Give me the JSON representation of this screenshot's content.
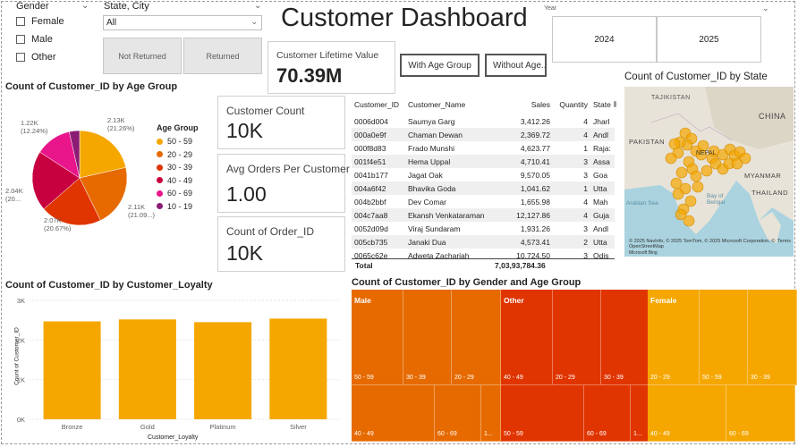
{
  "title": "Customer Dashboard",
  "slicers": {
    "gender": {
      "title": "Gender",
      "options": [
        "Female",
        "Male",
        "Other"
      ]
    },
    "state_city": {
      "title": "State, City",
      "selected": "All"
    },
    "returned": {
      "tiles": [
        "Not Returned",
        "Returned"
      ]
    },
    "year": {
      "title": "Year",
      "tiles": [
        "2024",
        "2025"
      ]
    }
  },
  "buttons": {
    "age": "With Age Group",
    "no_age": "Without Age..."
  },
  "cards": {
    "clv": {
      "label": "Customer Lifetime Value",
      "value": "70.39M"
    },
    "count": {
      "label": "Customer Count",
      "value": "10K"
    },
    "avg": {
      "label": "Avg Orders Per Customer",
      "value": "1.00"
    },
    "orders": {
      "label": "Count of Order_ID",
      "value": "10K"
    }
  },
  "pie": {
    "title": "Count of Customer_ID by Age Group",
    "legend_title": "Age Group",
    "chart_data": {
      "type": "pie",
      "slices": [
        {
          "label": "50 - 59",
          "value": 2130,
          "pct": "21.26%",
          "color": "#F5A700",
          "top_label": "2.13K",
          "pct_label": "(21.26%)"
        },
        {
          "label": "20 - 29",
          "value": 2110,
          "pct": "21.09%",
          "color": "#E66A00",
          "top_label": "2.11K",
          "pct_label": "(21.09...)"
        },
        {
          "label": "30 - 39",
          "value": 2070,
          "pct": "20.67%",
          "color": "#E03500",
          "top_label": "2.07K",
          "pct_label": "(20.67%)"
        },
        {
          "label": "40 - 49",
          "value": 2040,
          "pct": "20...",
          "color": "#C7003F",
          "top_label": "2.04K",
          "pct_label": "(20..."
        },
        {
          "label": "60 - 69",
          "value": 1220,
          "pct": "12.24%",
          "color": "#E8168A",
          "top_label": "1.22K",
          "pct_label": "(12.24%)"
        },
        {
          "label": "10 - 19",
          "value": 350,
          "pct": "",
          "color": "#8B1C74",
          "top_label": "",
          "pct_label": ""
        }
      ]
    }
  },
  "table": {
    "headers": [
      "Customer_ID",
      "Customer_Name",
      "Sales",
      "Quantity",
      "State"
    ],
    "rows": [
      [
        "0006d004",
        "Saumya Garg",
        "3,412.26",
        "4",
        "Jharl"
      ],
      [
        "000a0e9f",
        "Chaman Dewan",
        "2,369.72",
        "4",
        "Andl"
      ],
      [
        "000f8d83",
        "Frado Munshi",
        "4,623.77",
        "1",
        "Raja:"
      ],
      [
        "001f4e51",
        "Hema Uppal",
        "4,710.41",
        "3",
        "Assa"
      ],
      [
        "0041b177",
        "Jagat Oak",
        "9,570.05",
        "3",
        "Goa"
      ],
      [
        "004a6f42",
        "Bhavika Goda",
        "1,041.62",
        "1",
        "Utta"
      ],
      [
        "004b2bbf",
        "Dev Comar",
        "1,655.98",
        "4",
        "Mah"
      ],
      [
        "004c7aa8",
        "Ekansh Venkataraman",
        "12,127.86",
        "4",
        "Guja"
      ],
      [
        "0052d09d",
        "Viraj Sundaram",
        "1,931.26",
        "3",
        "Andl"
      ],
      [
        "005cb735",
        "Janaki Dua",
        "4,573.41",
        "2",
        "Utta"
      ],
      [
        "0065c62e",
        "Adweta Zachariah",
        "10,724.50",
        "3",
        "Odis"
      ],
      [
        "",
        "",
        "",
        "",
        ""
      ]
    ],
    "total_label": "Total",
    "total_sales": "7,03,93,784.36"
  },
  "map": {
    "title": "Count of Customer_ID by State",
    "places": [
      "TAJIKISTAN",
      "CHINA",
      "PAKISTAN",
      "NEPAL",
      "MYANMAR",
      "THAILAND",
      "Arabian Sea",
      "Bay of Bengal"
    ],
    "attribution": "© 2025 NavInfo, © 2025 TomTom, © 2025 Microsoft Corporation, © OpenStreetMap",
    "brand": "Microsoft Bing",
    "terms": "Terms"
  },
  "bar": {
    "title": "Count of Customer_ID by Customer_Loyalty",
    "xlabel": "Customer_Loyalty",
    "ylabel": "Count of Customer_ID",
    "chart_data": {
      "type": "bar",
      "categories": [
        "Bronze",
        "Gold",
        "Platinum",
        "Silver"
      ],
      "values": [
        2470,
        2520,
        2450,
        2540
      ],
      "ylim": [
        0,
        3000
      ],
      "yticks": [
        "0K",
        "1K",
        "2K",
        "3K"
      ],
      "color": "#F5A700"
    }
  },
  "treemap": {
    "title": "Count of Customer_ID by Gender and Age Group",
    "groups": [
      "Male",
      "Other",
      "Female"
    ],
    "row1": [
      [
        "50 - 59",
        "30 - 39",
        "20 - 29"
      ],
      [
        "40 - 49",
        "20 - 29",
        "30 - 39"
      ],
      [
        "20 - 29",
        "50 - 59",
        "30 - 39"
      ]
    ],
    "row2": [
      [
        "40 - 49",
        "60 - 69",
        "1..."
      ],
      [
        "50 - 59",
        "60 - 69",
        "1..."
      ],
      [
        "40 - 49",
        "60 - 69"
      ]
    ],
    "colors": {
      "Male": "#E66A00",
      "Other": "#E03500",
      "Female": "#F5A700"
    }
  }
}
